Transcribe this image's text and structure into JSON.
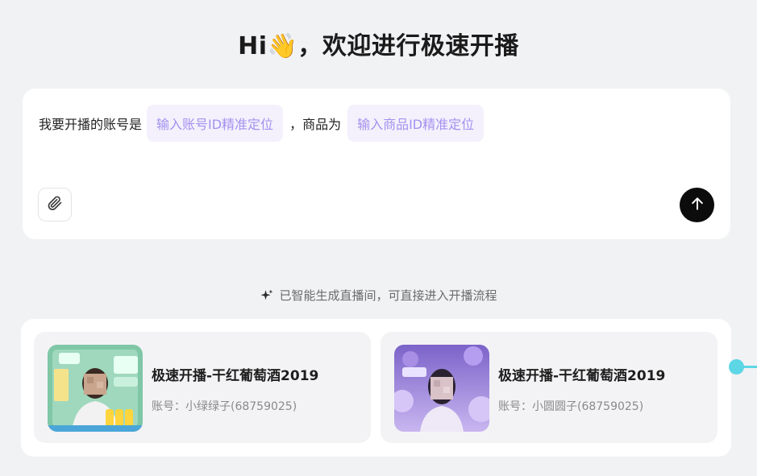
{
  "header": {
    "title": "Hi👋，欢迎进行极速开播"
  },
  "composer": {
    "prefix": "我要开播的账号是",
    "account_chip": "输入账号ID精准定位",
    "middle": "，商品为",
    "product_chip": "输入商品ID精准定位",
    "attach_icon": "paperclip-icon",
    "send_icon": "arrow-up-icon"
  },
  "hint": {
    "text": "已智能生成直播间，可直接进入开播流程",
    "icon": "sparkle-icon"
  },
  "cards": [
    {
      "title": "极速开播-干红葡萄酒2019",
      "account": "账号：小绿绿子(68759025)"
    },
    {
      "title": "极速开播-干红葡萄酒2019",
      "account": "账号：小圆圆子(68759025)"
    }
  ],
  "colors": {
    "accent_chip_text": "#a491ee",
    "accent_chip_bg": "#f4f1fd",
    "side_indicator": "#5dd6e6"
  }
}
